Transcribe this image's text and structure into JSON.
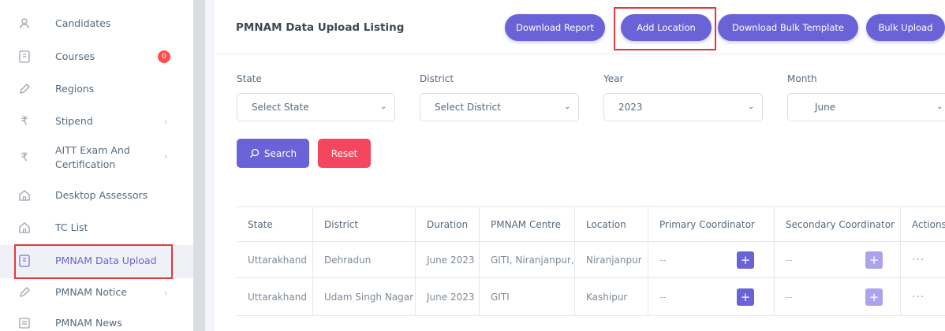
{
  "sidebar": {
    "items": [
      {
        "label": "Candidates",
        "icon": "candidates-icon"
      },
      {
        "label": "Courses",
        "icon": "courses-icon",
        "badge": "0"
      },
      {
        "label": "Regions",
        "icon": "pencil-icon"
      },
      {
        "label": "Stipend",
        "icon": "rupee-icon"
      },
      {
        "label": "AITT Exam And",
        "label2": "Certification",
        "icon": "rupee-icon"
      },
      {
        "label": "Desktop Assessors",
        "icon": "home-icon"
      },
      {
        "label": "TC List",
        "icon": "home-icon"
      },
      {
        "label": "PMNAM Data Upload",
        "icon": "document-icon"
      },
      {
        "label": "PMNAM Notice",
        "icon": "pencil-icon"
      },
      {
        "label": "PMNAM News",
        "icon": "news-icon"
      }
    ]
  },
  "header": {
    "title": "PMNAM Data Upload Listing",
    "buttons": {
      "download_report": "Download Report",
      "add_location": "Add Location",
      "download_bulk_template": "Download Bulk Template",
      "bulk_upload": "Bulk Upload"
    }
  },
  "filters": {
    "state": {
      "label": "State",
      "value": "Select State"
    },
    "district": {
      "label": "District",
      "value": "Select District"
    },
    "year": {
      "label": "Year",
      "value": "2023"
    },
    "month": {
      "label": "Month",
      "value": "June"
    },
    "search_label": "Search",
    "reset_label": "Reset"
  },
  "table": {
    "headers": [
      "State",
      "District",
      "Duration",
      "PMNAM Centre",
      "Location",
      "Primary Coordinator",
      "Secondary Coordinator",
      "Actions"
    ],
    "rows": [
      {
        "state": "Uttarakhand",
        "district": "Dehradun",
        "duration": "June 2023",
        "centre": "GITI, Niranjanpur,",
        "location": "Niranjanpur",
        "primary": "--",
        "secondary": "--",
        "actions": "···"
      },
      {
        "state": "Uttarakhand",
        "district": "Udam Singh Nagar",
        "duration": "June 2023",
        "centre": "GITI",
        "location": "Kashipur",
        "primary": "--",
        "secondary": "--",
        "actions": "···"
      }
    ]
  },
  "colors": {
    "primary": "#6a63d8",
    "danger": "#f5455f",
    "highlight": "#e23a3a"
  }
}
